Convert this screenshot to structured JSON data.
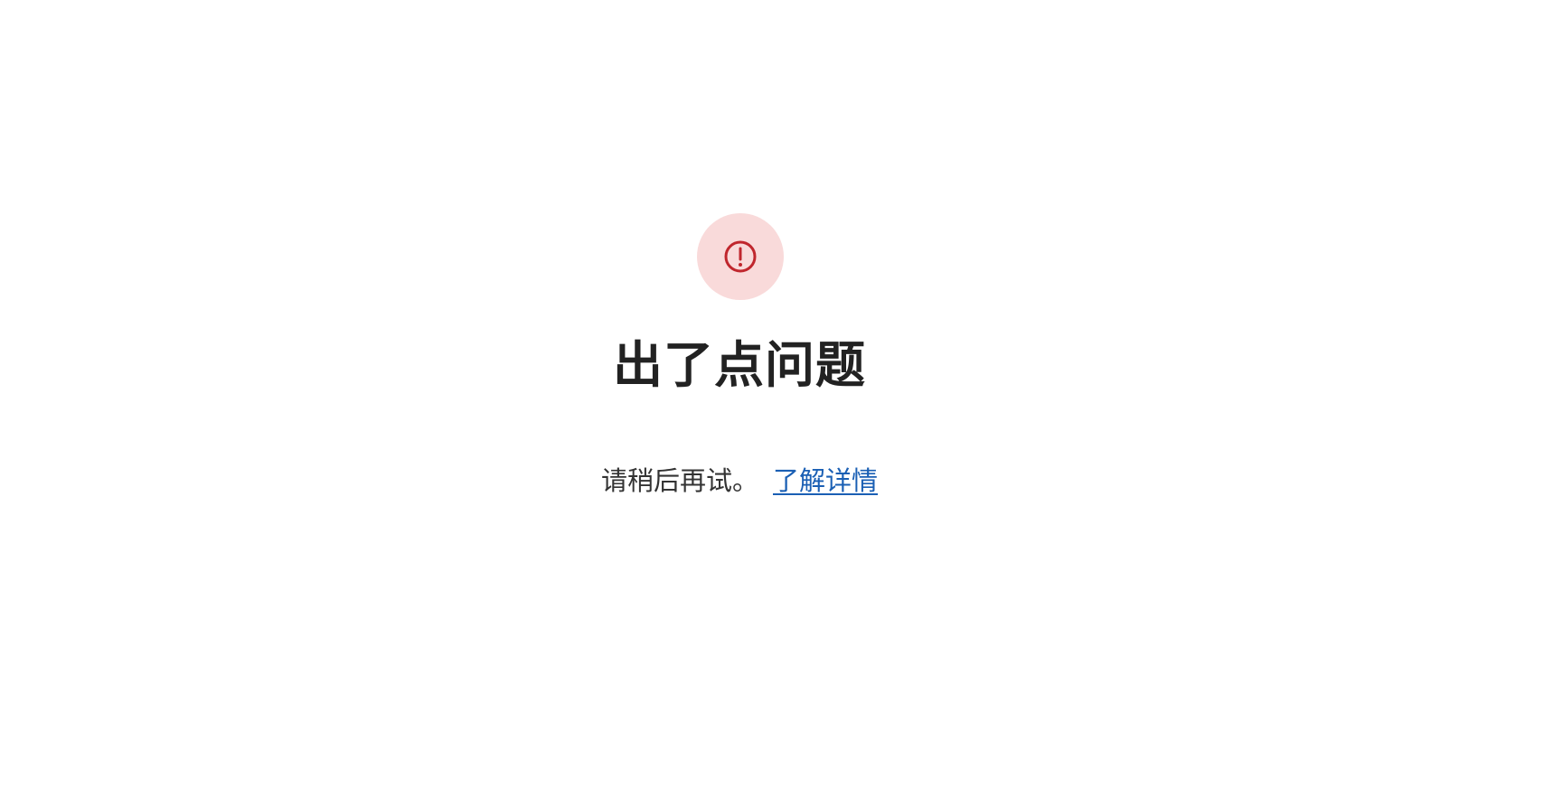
{
  "error": {
    "icon": "alert-circle-icon",
    "title": "出了点问题",
    "message": "请稍后再试。",
    "learn_more_label": "了解详情"
  },
  "colors": {
    "icon_badge_bg": "#f9dada",
    "icon_stroke": "#c0262d",
    "title_text": "#222222",
    "body_text": "#333333",
    "link": "#1a5fb4",
    "background": "#ffffff"
  }
}
